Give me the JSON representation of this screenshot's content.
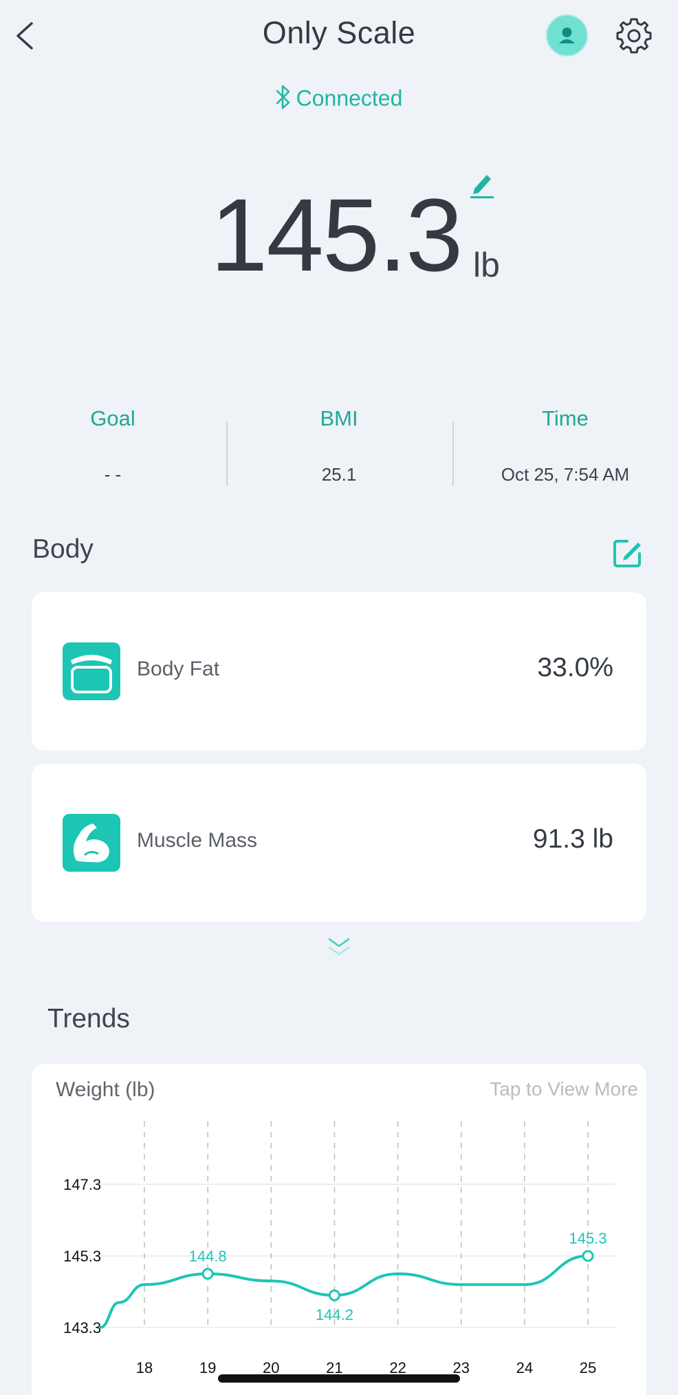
{
  "header": {
    "title": "Only Scale",
    "icons": {
      "back": "chevron-left-icon",
      "avatar": "user-avatar-icon",
      "settings": "gear-icon"
    }
  },
  "connection": {
    "status": "Connected",
    "icon": "bluetooth-icon"
  },
  "weight": {
    "value": "145.3",
    "unit": "lb",
    "edit_icon": "pencil-icon"
  },
  "stats": [
    {
      "label": "Goal",
      "value": "- -"
    },
    {
      "label": "BMI",
      "value": "25.1"
    },
    {
      "label": "Time",
      "value": "Oct 25, 7:54 AM"
    }
  ],
  "body": {
    "heading": "Body",
    "edit_icon": "edit-square-icon",
    "items": [
      {
        "label": "Body Fat",
        "value": "33.0%",
        "icon": "body-fat-icon"
      },
      {
        "label": "Muscle Mass",
        "value": "91.3 lb",
        "icon": "muscle-icon"
      }
    ],
    "expand_icon": "double-chevron-down-icon"
  },
  "trends": {
    "heading": "Trends",
    "chart_title": "Weight (lb)",
    "view_more": "Tap to View More"
  },
  "colors": {
    "accent": "#1dc5b4",
    "accent_text": "#1fa896",
    "background": "#eff2f6"
  },
  "chart_data": {
    "type": "line",
    "title": "Weight (lb)",
    "xlabel": "",
    "ylabel": "",
    "x": [
      "18",
      "19",
      "20",
      "21",
      "22",
      "23",
      "24",
      "25"
    ],
    "x_values": [
      18,
      19,
      20,
      21,
      22,
      23,
      24,
      25
    ],
    "yticks": [
      "147.3",
      "145.3",
      "143.3"
    ],
    "ytick_values": [
      147.3,
      145.3,
      143.3
    ],
    "ylim": [
      143.3,
      147.3
    ],
    "xlim": [
      17.3,
      25.45
    ],
    "series": [
      {
        "x": [
          17.3,
          17.6,
          18.0,
          19.0,
          20.0,
          21.0,
          22.0,
          23.0,
          24.0,
          25.0
        ],
        "y": [
          143.3,
          144.0,
          144.5,
          144.8,
          144.6,
          144.2,
          144.8,
          144.5,
          144.5,
          145.3
        ]
      }
    ],
    "highlighted": [
      {
        "x": 19,
        "y": 144.8,
        "label": "144.8",
        "label_pos": "above"
      },
      {
        "x": 21,
        "y": 144.2,
        "label": "144.2",
        "label_pos": "below"
      },
      {
        "x": 25,
        "y": 145.3,
        "label": "145.3",
        "label_pos": "above"
      }
    ],
    "grid": "dashed-vertical",
    "color": "#1dc5b4"
  }
}
